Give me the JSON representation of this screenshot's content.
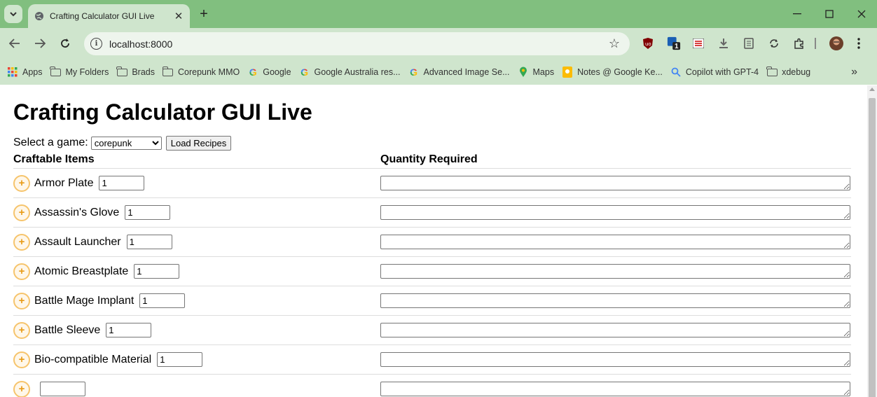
{
  "browser": {
    "tab_title": "Crafting Calculator GUI Live",
    "url": "localhost:8000",
    "extension_badge": "1",
    "bookmarks": [
      {
        "label": "Apps",
        "icon": "apps-grid-icon"
      },
      {
        "label": "My Folders",
        "icon": "folder-icon"
      },
      {
        "label": "Brads",
        "icon": "folder-icon"
      },
      {
        "label": "Corepunk MMO",
        "icon": "folder-icon"
      },
      {
        "label": "Google",
        "icon": "google-icon"
      },
      {
        "label": "Google Australia res...",
        "icon": "google-icon"
      },
      {
        "label": "Advanced Image Se...",
        "icon": "google-icon"
      },
      {
        "label": "Maps",
        "icon": "maps-pin-icon"
      },
      {
        "label": "Notes @ Google Ke...",
        "icon": "keep-icon"
      },
      {
        "label": "Copilot with GPT-4",
        "icon": "search-icon"
      },
      {
        "label": "xdebug",
        "icon": "folder-icon"
      }
    ],
    "overflow_label": "»"
  },
  "page": {
    "title": "Crafting Calculator GUI Live",
    "select_label": "Select a game:",
    "game_selected": "corepunk",
    "load_button": "Load Recipes",
    "col_items": "Craftable Items",
    "col_quantity": "Quantity Required",
    "plus_symbol": "+",
    "items": [
      {
        "name": "Armor Plate",
        "qty": "1"
      },
      {
        "name": "Assassin's Glove",
        "qty": "1"
      },
      {
        "name": "Assault Launcher",
        "qty": "1"
      },
      {
        "name": "Atomic Breastplate",
        "qty": "1"
      },
      {
        "name": "Battle Mage Implant",
        "qty": "1"
      },
      {
        "name": "Battle Sleeve",
        "qty": "1"
      },
      {
        "name": "Bio-compatible Material",
        "qty": "1"
      },
      {
        "name": "",
        "qty": ""
      }
    ]
  },
  "colors": {
    "chrome_green": "#81bf7f",
    "toolbar_green": "#cfe5cd",
    "plus_accent": "#e89b17"
  }
}
